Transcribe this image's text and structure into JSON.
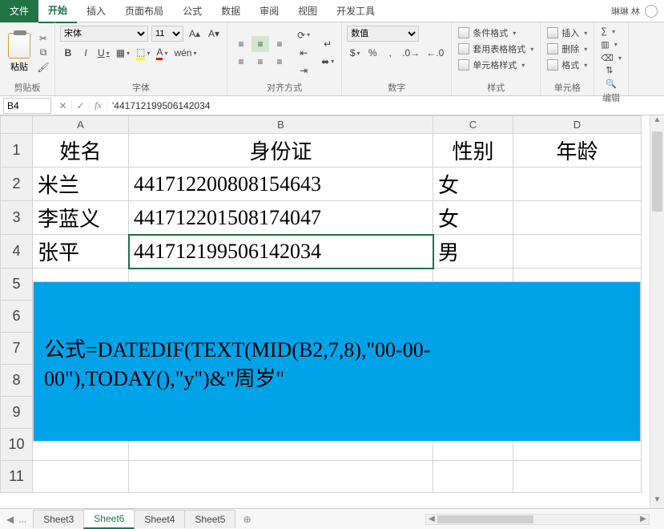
{
  "tabs": {
    "file": "文件",
    "items": [
      "开始",
      "插入",
      "页面布局",
      "公式",
      "数据",
      "审阅",
      "视图",
      "开发工具"
    ],
    "active_index": 0
  },
  "user_name": "琳琳 林",
  "ribbon": {
    "clipboard": {
      "paste": "粘贴",
      "label": "剪贴板"
    },
    "font": {
      "name": "宋体",
      "size": "11",
      "label": "字体",
      "bold": "B",
      "italic": "I",
      "underline": "U",
      "wen": "wén"
    },
    "align": {
      "label": "对齐方式",
      "wrap": "㐂",
      "merge": "合"
    },
    "number": {
      "format": "数值",
      "label": "数字"
    },
    "styles": {
      "cond": "条件格式",
      "tbl": "套用表格格式",
      "cell": "单元格样式",
      "label": "样式"
    },
    "cells": {
      "insert": "插入",
      "delete": "删除",
      "format": "格式",
      "label": "单元格"
    },
    "edit": {
      "label": "编辑"
    }
  },
  "formula_bar": {
    "name_box": "B4",
    "content": "'441712199506142034"
  },
  "grid": {
    "columns": [
      "A",
      "B",
      "C",
      "D"
    ],
    "headers": {
      "A": "姓名",
      "B": "身份证",
      "C": "性别",
      "D": "年龄"
    },
    "rows": [
      {
        "n": 2,
        "A": "米兰",
        "B": "441712200808154643",
        "C": "女",
        "D": ""
      },
      {
        "n": 3,
        "A": "李蓝义",
        "B": "441712201508174047",
        "C": "女",
        "D": ""
      },
      {
        "n": 4,
        "A": "张平",
        "B": "441712199506142034",
        "C": "男",
        "D": ""
      }
    ],
    "selected_cell": "B4",
    "overlay_formula": "公式=DATEDIF(TEXT(MID(B2,7,8),\"00-00-00\"),TODAY(),\"y\")&\"周岁\""
  },
  "sheet_tabs": {
    "items": [
      "Sheet3",
      "Sheet6",
      "Sheet4",
      "Sheet5"
    ],
    "active_index": 1,
    "ellipsis": "..."
  }
}
